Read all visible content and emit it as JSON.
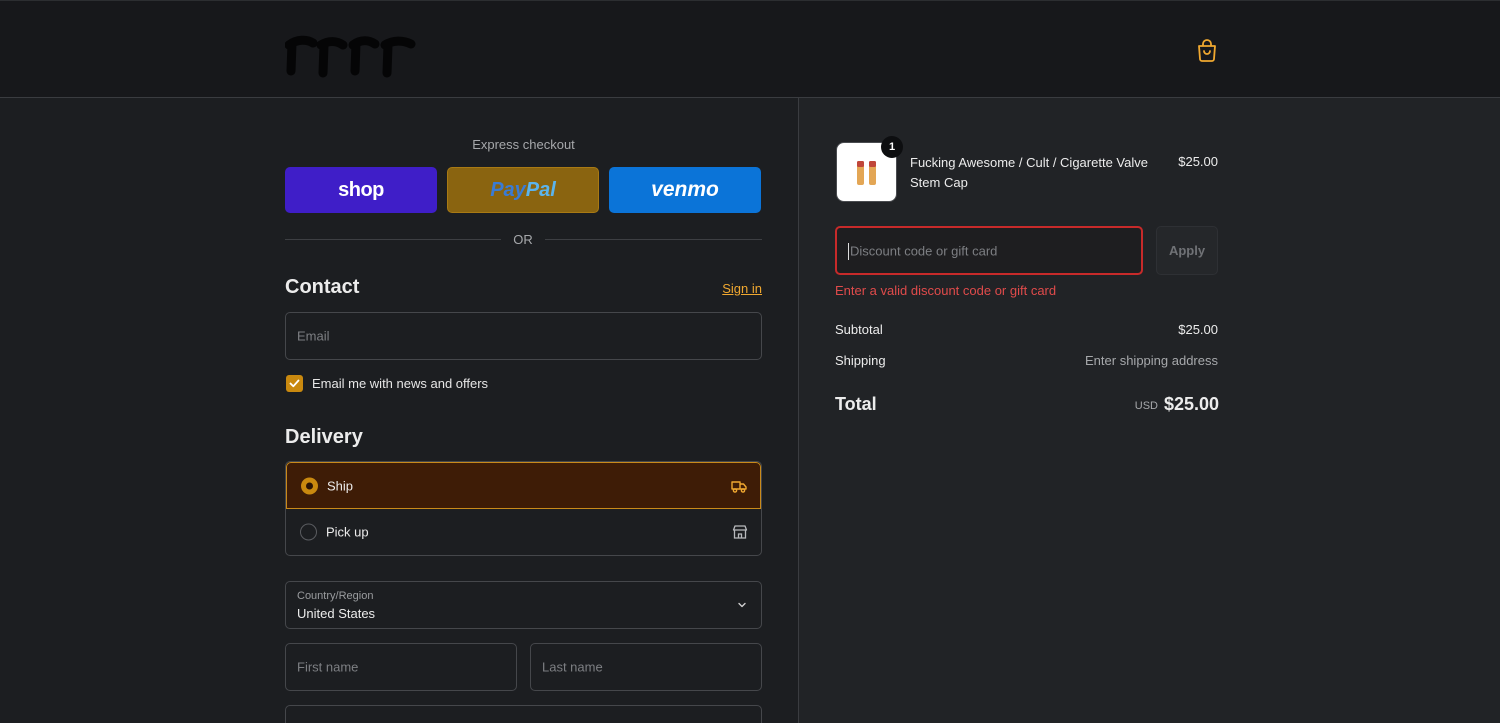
{
  "header": {
    "logo_icon": "brand-logo-handwritten",
    "cart_icon": "shopping-bag-icon",
    "accent_color": "#f0a830"
  },
  "express": {
    "title": "Express checkout",
    "buttons": {
      "shop": "shop",
      "paypal_pay": "Pay",
      "paypal_pal": "Pal",
      "venmo": "venmo"
    },
    "or_text": "OR"
  },
  "contact": {
    "title": "Contact",
    "signin": "Sign in",
    "email_placeholder": "Email",
    "news_checkbox": {
      "label": "Email me with news and offers",
      "checked": true
    }
  },
  "delivery": {
    "title": "Delivery",
    "options": [
      {
        "label": "Ship",
        "selected": true,
        "icon": "truck-icon"
      },
      {
        "label": "Pick up",
        "selected": false,
        "icon": "store-icon"
      }
    ],
    "country": {
      "label": "Country/Region",
      "value": "United States"
    },
    "first_name_placeholder": "First name",
    "last_name_placeholder": "Last name"
  },
  "summary": {
    "item": {
      "quantity": "1",
      "title": "Fucking Awesome / Cult / Cigarette Valve Stem Cap",
      "price": "$25.00"
    },
    "discount": {
      "placeholder": "Discount code or gift card",
      "apply": "Apply",
      "error": "Enter a valid discount code or gift card"
    },
    "subtotal_label": "Subtotal",
    "subtotal_value": "$25.00",
    "shipping_label": "Shipping",
    "shipping_value": "Enter shipping address",
    "total_label": "Total",
    "currency": "USD",
    "total_value": "$25.00"
  }
}
